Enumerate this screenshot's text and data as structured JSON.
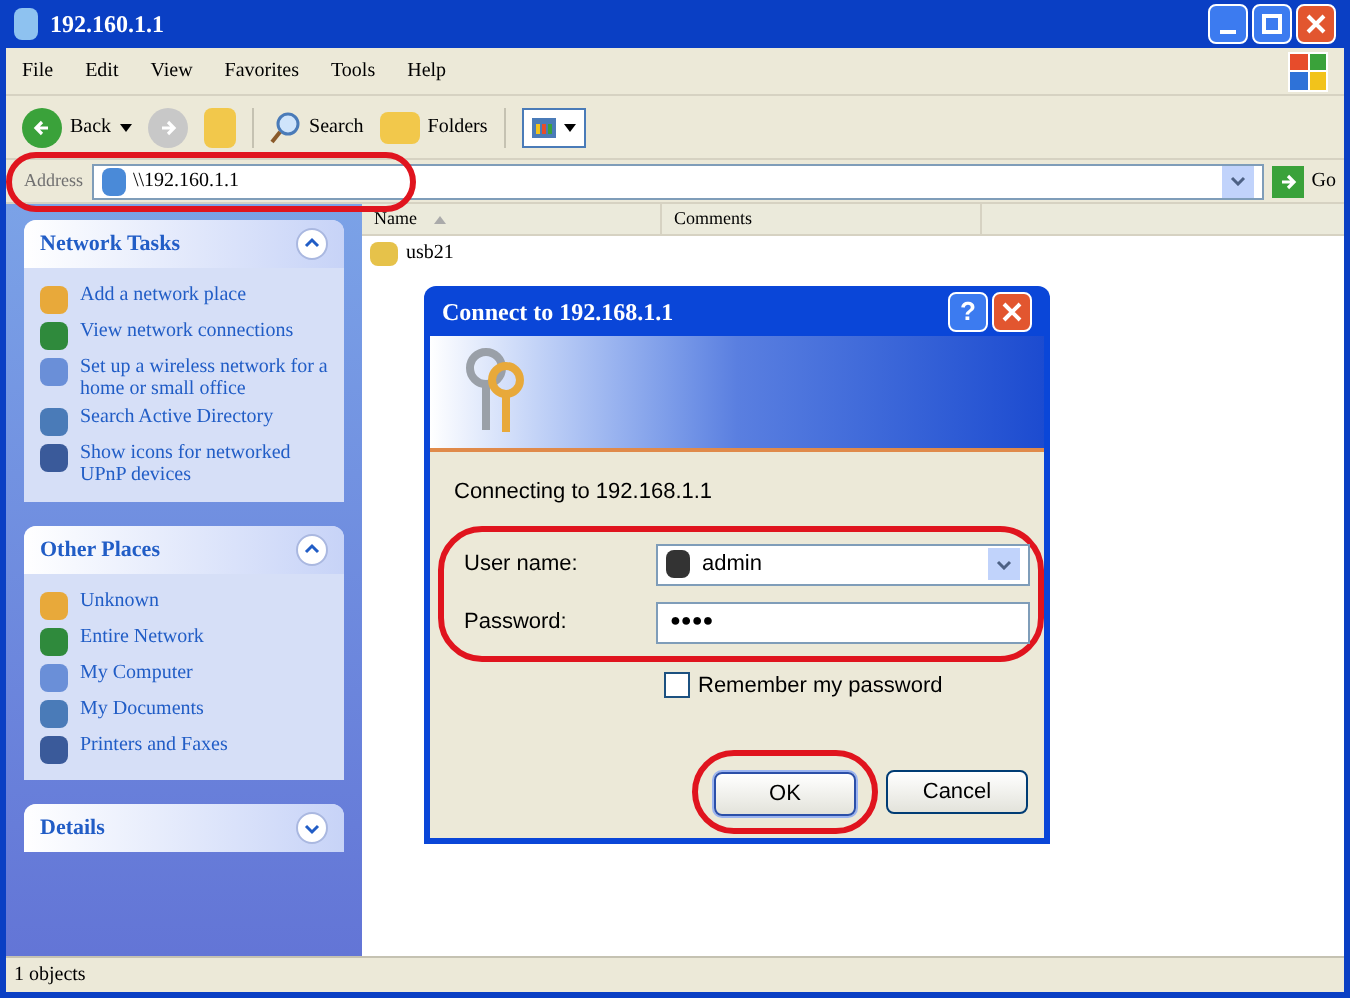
{
  "window": {
    "title": "192.160.1.1"
  },
  "menu": [
    "File",
    "Edit",
    "View",
    "Favorites",
    "Tools",
    "Help"
  ],
  "toolbar": {
    "back": "Back",
    "search": "Search",
    "folders": "Folders"
  },
  "address": {
    "label": "Address",
    "value": "\\\\192.160.1.1",
    "go": "Go"
  },
  "sidebar": {
    "panels": [
      {
        "title": "Network Tasks",
        "expanded": true,
        "items": [
          "Add a network place",
          "View network connections",
          "Set up a wireless network for a home or small office",
          "Search Active Directory",
          "Show icons for networked UPnP devices"
        ]
      },
      {
        "title": "Other Places",
        "expanded": true,
        "items": [
          "Unknown",
          "Entire Network",
          "My Computer",
          "My Documents",
          "Printers and Faxes"
        ]
      },
      {
        "title": "Details",
        "expanded": false
      }
    ]
  },
  "columns": [
    "Name",
    "Comments"
  ],
  "files": [
    {
      "name": "usb21"
    }
  ],
  "status_bar": "1 objects",
  "dialog": {
    "title": "Connect to 192.168.1.1",
    "help": "?",
    "message": "Connecting to 192.168.1.1",
    "username_label": "User name:",
    "username": "admin",
    "password_label": "Password:",
    "password": "●●●●",
    "remember": {
      "label": "Remember my password",
      "checked": false
    },
    "buttons": [
      "OK",
      "Cancel"
    ]
  }
}
